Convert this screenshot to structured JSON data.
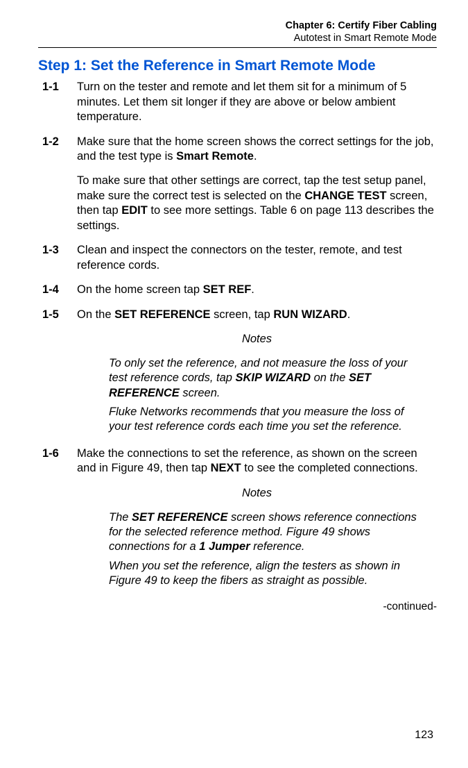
{
  "header": {
    "chapter": "Chapter 6: Certify Fiber Cabling",
    "subtitle": "Autotest in Smart Remote Mode"
  },
  "title": "Step 1: Set the Reference in Smart Remote Mode",
  "steps": {
    "s1": {
      "num": "1-1",
      "p1": "Turn on the tester and remote and let them sit for a minimum of 5 minutes. Let them sit longer if they are above or below ambient temperature."
    },
    "s2": {
      "num": "1-2",
      "p1a": "Make sure that the home screen shows the correct settings for the job, and the test type is ",
      "p1b": "Smart Remote",
      "p1c": ".",
      "p2a": "To make sure that other settings are correct, tap the test setup panel, make sure the correct test is selected on the ",
      "p2b": "CHANGE TEST",
      "p2c": " screen, then tap ",
      "p2d": "EDIT",
      "p2e": " to see more settings. Table 6 on page 113 describes the settings."
    },
    "s3": {
      "num": "1-3",
      "p1": "Clean and inspect the connectors on the tester, remote, and test reference cords."
    },
    "s4": {
      "num": "1-4",
      "p1a": "On the home screen tap ",
      "p1b": "SET REF",
      "p1c": "."
    },
    "s5": {
      "num": "1-5",
      "p1a": "On the ",
      "p1b": "SET REFERENCE",
      "p1c": " screen, tap ",
      "p1d": "RUN WIZARD",
      "p1e": "."
    },
    "s6": {
      "num": "1-6",
      "p1a": "Make the connections to set the reference, as shown on the screen and in Figure 49, then tap ",
      "p1b": "NEXT",
      "p1c": " to see the completed connections."
    }
  },
  "notes1": {
    "label": "Notes",
    "p1a": "To only set the reference, and not measure the loss of your test reference cords, tap ",
    "p1b": "SKIP WIZARD",
    "p1c": " on the ",
    "p1d": "SET REFERENCE",
    "p1e": " screen.",
    "p2": "Fluke Networks recommends that you measure the loss of your test reference cords each time you set the reference."
  },
  "notes2": {
    "label": "Notes",
    "p1a": "The ",
    "p1b": "SET REFERENCE",
    "p1c": " screen shows reference connections for the selected reference method. Figure 49 shows connections for a ",
    "p1d": "1 Jumper",
    "p1e": " reference.",
    "p2": "When you set the reference, align the testers as shown in Figure 49 to keep the fibers as straight as possible."
  },
  "continued": "-continued-",
  "pageNumber": "123"
}
